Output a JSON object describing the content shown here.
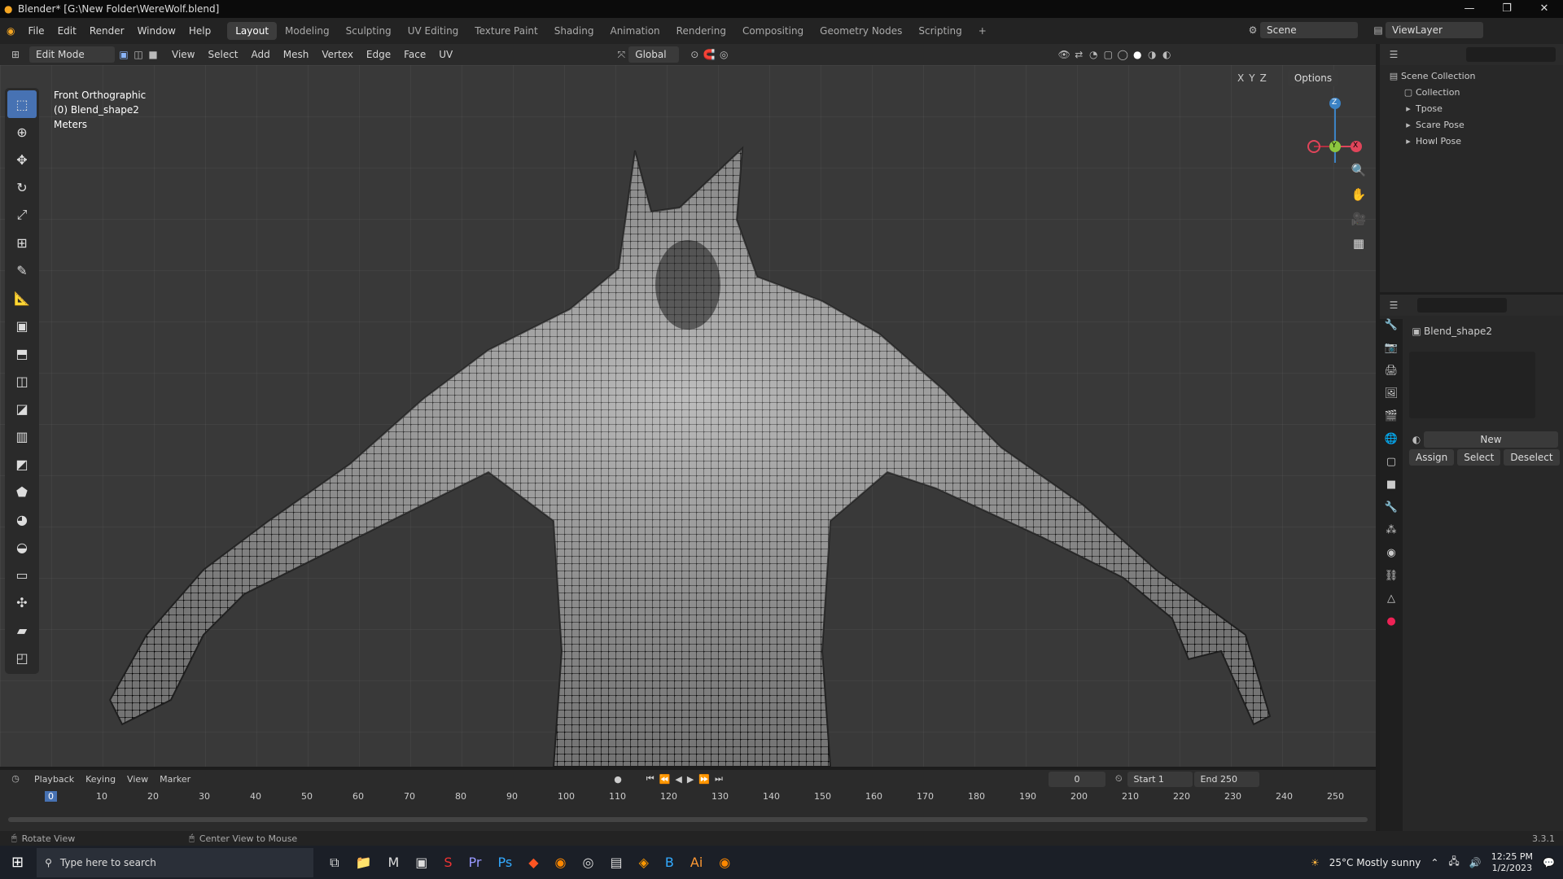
{
  "window": {
    "title": "Blender* [G:\\New Folder\\WereWolf.blend]",
    "controls": [
      "—",
      "❐",
      "✕"
    ]
  },
  "menus": [
    "File",
    "Edit",
    "Render",
    "Window",
    "Help"
  ],
  "workspaces": [
    "Layout",
    "Modeling",
    "Sculpting",
    "UV Editing",
    "Texture Paint",
    "Shading",
    "Animation",
    "Rendering",
    "Compositing",
    "Geometry Nodes",
    "Scripting",
    "+"
  ],
  "scene": {
    "label": "Scene",
    "viewlayer": "ViewLayer"
  },
  "vp": {
    "mode": "Edit Mode",
    "menus": [
      "View",
      "Select",
      "Add",
      "Mesh",
      "Vertex",
      "Edge",
      "Face",
      "UV"
    ],
    "orientation": "Global",
    "options": "Options",
    "axes": [
      "X",
      "Y",
      "Z"
    ]
  },
  "vpinfo": {
    "view": "Front Orthographic",
    "object": "(0) Blend_shape2",
    "units": "Meters"
  },
  "gizmo": {
    "z": "Z",
    "y": "Y",
    "x": "X"
  },
  "outliner": {
    "root": "Scene Collection",
    "items": [
      "Collection",
      "Tpose",
      "Scare Pose",
      "Howl Pose"
    ]
  },
  "props": {
    "object": "Blend_shape2",
    "new": "New",
    "assign": "Assign",
    "select": "Select",
    "deselect": "Deselect"
  },
  "timeline": {
    "menus": [
      "Playback",
      "Keying",
      "View",
      "Marker"
    ],
    "frame": "0",
    "start_label": "Start",
    "start": "1",
    "end_label": "End",
    "end": "250",
    "ticks": [
      "0",
      "10",
      "20",
      "30",
      "40",
      "50",
      "60",
      "70",
      "80",
      "90",
      "100",
      "110",
      "120",
      "130",
      "140",
      "150",
      "160",
      "170",
      "180",
      "190",
      "200",
      "210",
      "220",
      "230",
      "240",
      "250"
    ]
  },
  "status": {
    "left": "Rotate View",
    "mid": "Center View to Mouse",
    "version": "3.3.1"
  },
  "taskbar": {
    "search": "Type here to search",
    "weather": "25°C  Mostly sunny",
    "time": "12:25 PM",
    "date": "1/2/2023"
  }
}
